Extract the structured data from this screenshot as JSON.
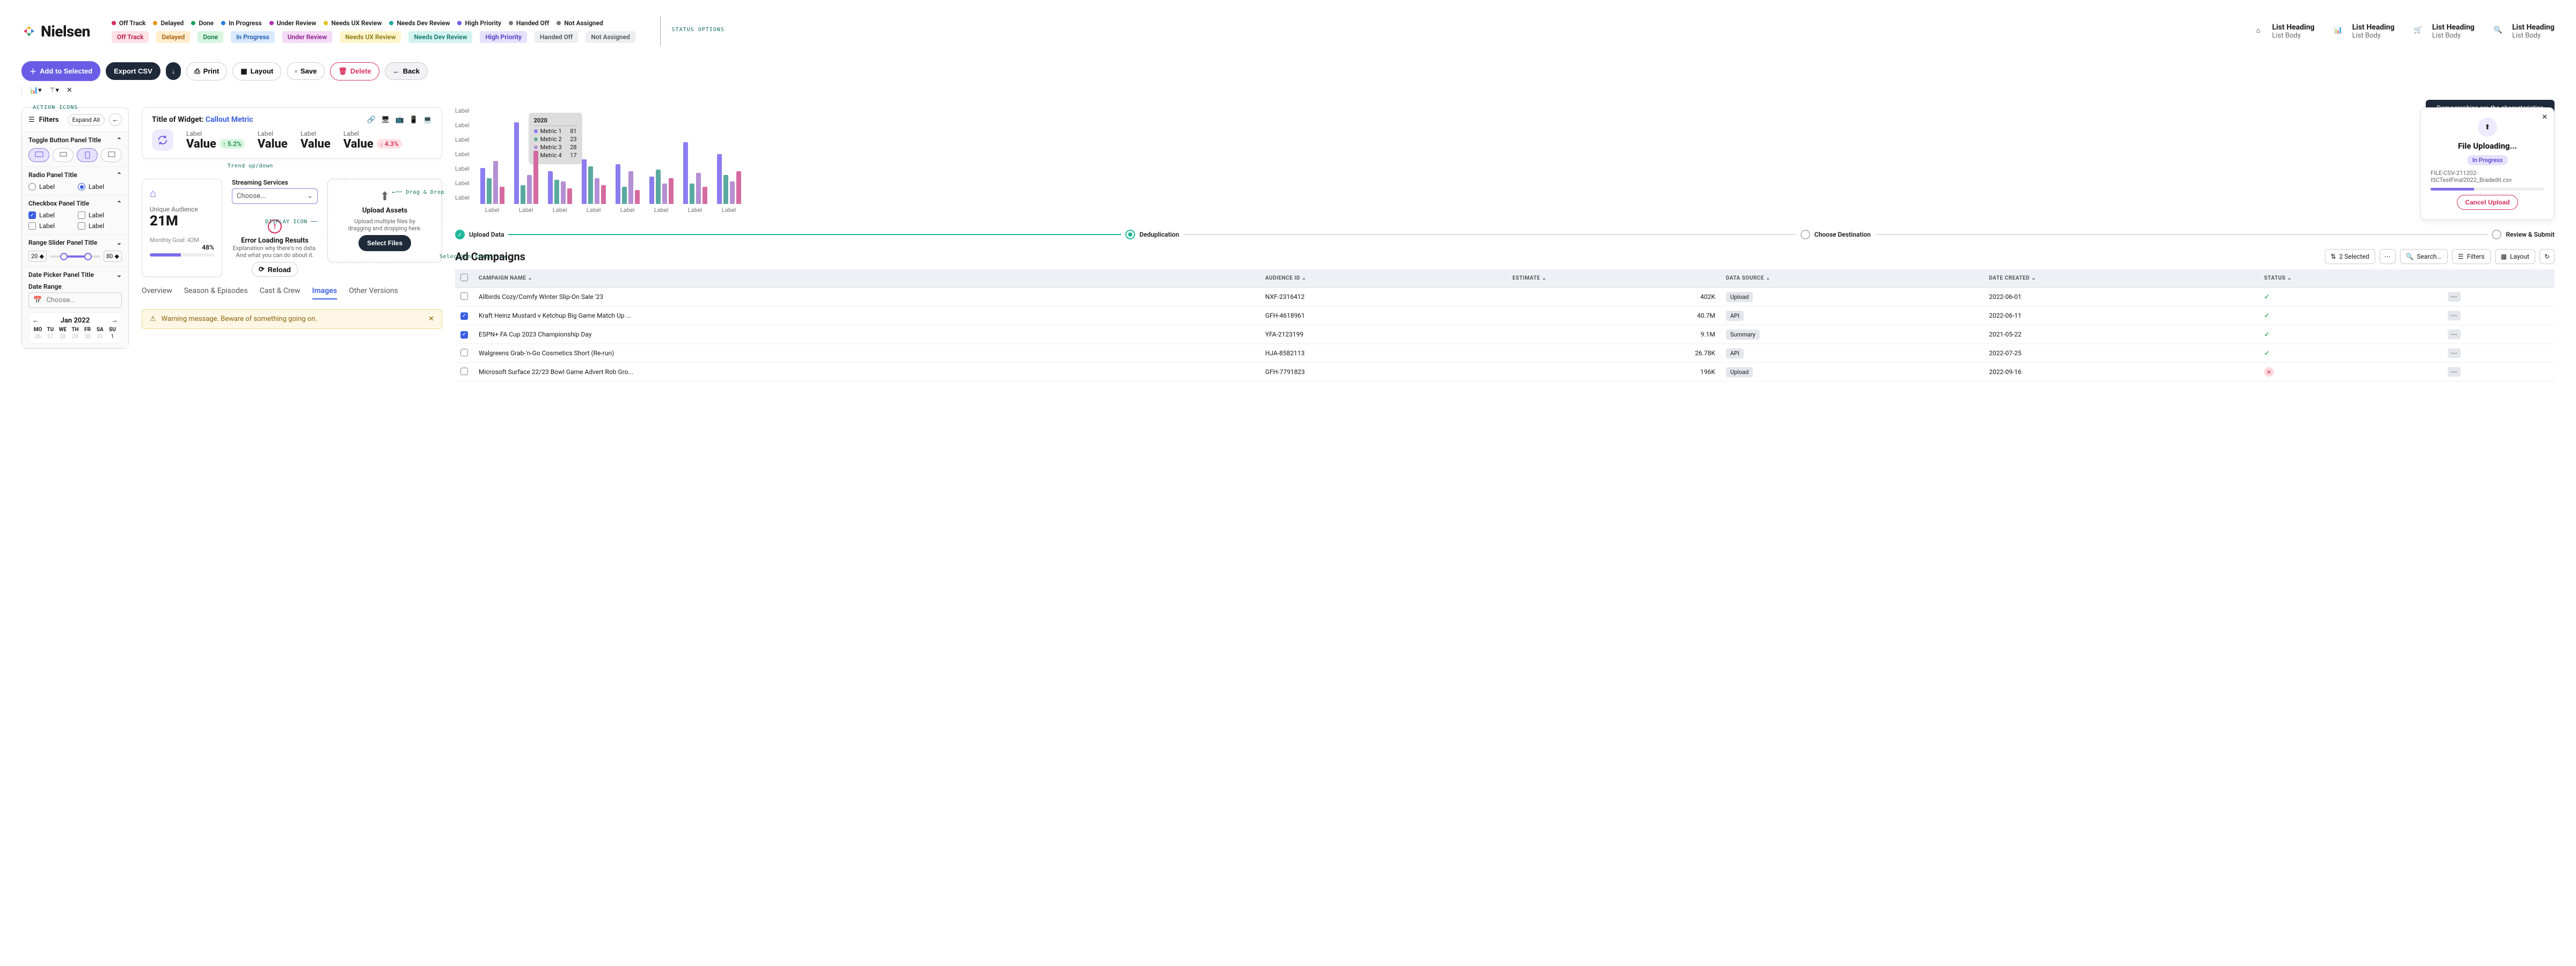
{
  "logo": {
    "text": "Nielsen"
  },
  "status_options_label": "STATUS OPTIONS",
  "statuses": [
    {
      "label": "Off Track",
      "dot": "#d62f5a",
      "pill_bg": "#ffe1e6",
      "pill_fg": "#b31c46"
    },
    {
      "label": "Delayed",
      "dot": "#e5941d",
      "pill_bg": "#ffeccc",
      "pill_fg": "#a35f0c"
    },
    {
      "label": "Done",
      "dot": "#1fa35c",
      "pill_bg": "#d7f5e1",
      "pill_fg": "#177a44"
    },
    {
      "label": "In Progress",
      "dot": "#2c7fe0",
      "pill_bg": "#dbe9ff",
      "pill_fg": "#1c5bb0"
    },
    {
      "label": "Under Review",
      "dot": "#b02fb0",
      "pill_bg": "#f5dbf5",
      "pill_fg": "#8a1e8a"
    },
    {
      "label": "Needs UX Review",
      "dot": "#e0c21d",
      "pill_bg": "#fff5cc",
      "pill_fg": "#8a7710"
    },
    {
      "label": "Needs Dev Review",
      "dot": "#1ea9a0",
      "pill_bg": "#d4f2ef",
      "pill_fg": "#12766f"
    },
    {
      "label": "High Priority",
      "dot": "#6b5ce5",
      "pill_bg": "#e5e1ff",
      "pill_fg": "#4a3cc0"
    },
    {
      "label": "Handed Off",
      "dot": "#777",
      "pill_bg": "#eceef1",
      "pill_fg": "#555"
    },
    {
      "label": "Not Assigned",
      "dot": "#777",
      "pill_bg": "#eceef1",
      "pill_fg": "#555"
    }
  ],
  "list_headings": [
    {
      "title": "List Heading",
      "body": "List Body"
    },
    {
      "title": "List Heading",
      "body": "List Body"
    },
    {
      "title": "List Heading",
      "body": "List Body"
    },
    {
      "title": "List Heading",
      "body": "List Body"
    }
  ],
  "actions": {
    "add": "Add to Selected",
    "export": "Export CSV",
    "print": "Print",
    "layout": "Layout",
    "save": "Save",
    "delete": "Delete",
    "back": "Back",
    "action_icons_label": "ACTION ICONS"
  },
  "filters": {
    "title": "Filters",
    "expand": "Expand All",
    "toggle_title": "Toggle Button Panel Title",
    "radio_title": "Radio Panel Title",
    "radio_label": "Label",
    "check_title": "Checkbox Panel Title",
    "check_label": "Label",
    "range_title": "Range Slider Panel Title",
    "range_min": "20",
    "range_max": "80",
    "date_title": "Date Picker Panel Title",
    "date_range": "Date Range",
    "date_placeholder": "Choose...",
    "cal_month": "Jan 2022",
    "dow": [
      "MO",
      "TU",
      "WE",
      "TH",
      "FR",
      "SA",
      "SU"
    ],
    "cal_row": [
      "26",
      "27",
      "28",
      "29",
      "30",
      "31",
      "1"
    ]
  },
  "widget": {
    "title_pre": "Title of Widget: ",
    "title_callout": "Callout Metric",
    "metrics": [
      {
        "label": "Label",
        "value": "Value",
        "trend": "5.2%",
        "dir": "up"
      },
      {
        "label": "Label",
        "value": "Value"
      },
      {
        "label": "Label",
        "value": "Value"
      },
      {
        "label": "Label",
        "value": "Value",
        "trend": "4.3%",
        "dir": "down"
      }
    ],
    "trend_anno": "Trend up/down"
  },
  "mini": {
    "audience_label": "Unique Audience",
    "audience_value": "21M",
    "goal": "Monthly Goal: 42M",
    "pct": "48%",
    "progress": 48
  },
  "streaming": {
    "label": "Streaming Services",
    "placeholder": "Choose..."
  },
  "display_icon_anno": "DISPLAY ICON",
  "error": {
    "title": "Error Loading Results",
    "l1": "Explanation why there's no data.",
    "l2": "And what you can do about it.",
    "reload": "Reload"
  },
  "drop": {
    "title": "Upload Assets",
    "sub": "Upload multiple files by dragging and dropping here.",
    "btn": "Select Files",
    "anno": "Drag & Drop"
  },
  "tabs": [
    "Overview",
    "Season & Episodes",
    "Cast & Crew",
    "Images",
    "Other Versions"
  ],
  "tabs_active": 3,
  "alert": "Warning message. Beware of something going on.",
  "selection_anno": "Selection State",
  "chart_data": {
    "type": "bar",
    "ylabels": [
      "Label",
      "Label",
      "Label",
      "Label",
      "Label",
      "Label",
      "Label"
    ],
    "categories": [
      "Label",
      "Label",
      "Label",
      "Label",
      "Label",
      "Label",
      "Label"
    ],
    "series": [
      {
        "name": "Metric 1",
        "color": "#8b7cf0",
        "values": [
          42,
          95,
          38,
          52,
          46,
          32,
          72,
          58
        ]
      },
      {
        "name": "Metric 2",
        "color": "#5aa9a0",
        "values": [
          30,
          22,
          28,
          44,
          20,
          40,
          24,
          34
        ]
      },
      {
        "name": "Metric 3",
        "color": "#b48fd4",
        "values": [
          50,
          34,
          26,
          30,
          38,
          24,
          36,
          26
        ]
      },
      {
        "name": "Metric 4",
        "color": "#d46aa0",
        "values": [
          20,
          62,
          18,
          22,
          16,
          30,
          20,
          38
        ]
      }
    ],
    "tooltip": {
      "year": "2020",
      "rows": [
        [
          "Metric 1",
          "81"
        ],
        [
          "Metric 2",
          "23"
        ],
        [
          "Metric 3",
          "28"
        ],
        [
          "Metric 4",
          "17"
        ]
      ]
    }
  },
  "demo_tooltip": "Demographics are the characteristics of human populations and population segments.",
  "upload": {
    "title": "File Uploading...",
    "status": "In Progress",
    "file": "FILE-CSV-211202-ISCTestFinal2022_Bradedit.csv",
    "cancel": "Cancel Upload",
    "progress": 38
  },
  "stepper": [
    {
      "label": "Upload Data",
      "state": "done"
    },
    {
      "label": "Deduplication",
      "state": "active"
    },
    {
      "label": "Choose Destination",
      "state": "pending"
    },
    {
      "label": "Review & Submit",
      "state": "pending"
    }
  ],
  "campaigns": {
    "title": "Ad Campaigns",
    "selected": "2 Selected",
    "search": "Search...",
    "filters": "Filters",
    "layout": "Layout",
    "cols": [
      "CAMPAIGN NAME",
      "AUDIENCE ID",
      "ESTIMATE",
      "DATA SOURCE",
      "DATE CREATED",
      "STATUS"
    ],
    "rows": [
      {
        "sel": false,
        "name": "Allbirds Cozy/Comfy Winter Slip-On Sale '23",
        "aud": "NXF-2316412",
        "est": "402K",
        "src": "Upload",
        "date": "2022-06-01",
        "ok": true
      },
      {
        "sel": true,
        "name": "Kraft Heinz Mustard v Ketchup Big Game Match Up ...",
        "aud": "GFH-4618961",
        "est": "40.7M",
        "src": "API",
        "date": "2022-06-11",
        "ok": true
      },
      {
        "sel": true,
        "name": "ESPN+ FA Cup 2023 Championship Day",
        "aud": "YFA-2123199",
        "est": "9.1M",
        "src": "Summary",
        "date": "2021-05-22",
        "ok": true
      },
      {
        "sel": false,
        "name": "Walgreens Grab-'n-Go Cosmetics Short (Re-run)",
        "aud": "HJA-8582113",
        "est": "26.78K",
        "src": "API",
        "date": "2022-07-25",
        "ok": true
      },
      {
        "sel": false,
        "name": "Microsoft Surface 22/23 Bowl Game Advert Rob Gro...",
        "aud": "GFH-7791823",
        "est": "196K",
        "src": "Upload",
        "date": "2022-09-16",
        "ok": false
      }
    ]
  }
}
